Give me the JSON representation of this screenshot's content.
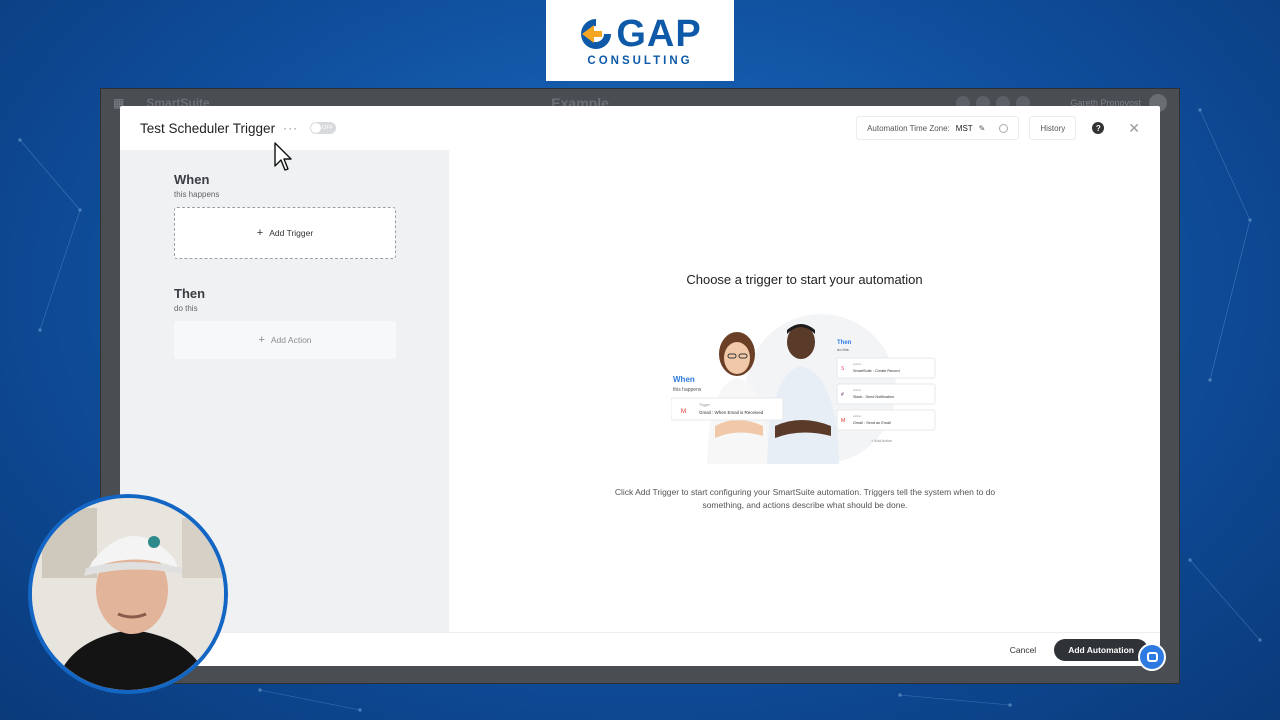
{
  "logo": {
    "name": "GAP",
    "subtitle": "CONSULTING"
  },
  "app_bar": {
    "brand": "SmartSuite",
    "workspace": "Example",
    "user": "Gareth Pronovost"
  },
  "modal": {
    "title": "Test Scheduler Trigger",
    "more": "···",
    "toggle_label": "OFF",
    "timezone_label": "Automation Time Zone:",
    "timezone_value": "MST",
    "history_label": "History",
    "help_label": "?",
    "close_label": "✕"
  },
  "when": {
    "title": "When",
    "subtitle": "this happens",
    "add_trigger": "Add Trigger"
  },
  "then": {
    "title": "Then",
    "subtitle": "do this",
    "add_action": "Add Action"
  },
  "empty_state": {
    "title": "Choose a trigger to start your automation",
    "description": "Click Add Trigger to start configuring your SmartSuite automation. Triggers tell the system when to do something, and actions describe what should be done."
  },
  "illustration": {
    "when_title": "When",
    "when_sub": "this happens",
    "trigger_tag": "Trigger",
    "trigger_text": "Gmail : When Email is Received",
    "then_title": "Then",
    "then_sub": "do this",
    "actions": [
      {
        "tag": "Action",
        "text": "SmartSuite : Create Record"
      },
      {
        "tag": "Action",
        "text": "Slack : Send Notification"
      },
      {
        "tag": "Action",
        "text": "Gmail : Send an Email"
      }
    ],
    "add_action": "+ Add Action"
  },
  "footer": {
    "cancel": "Cancel",
    "add_automation": "Add Automation"
  },
  "colors": {
    "brand_blue": "#0e5aa8",
    "footer_button": "#2f3236",
    "background": "#0f4e9c"
  }
}
